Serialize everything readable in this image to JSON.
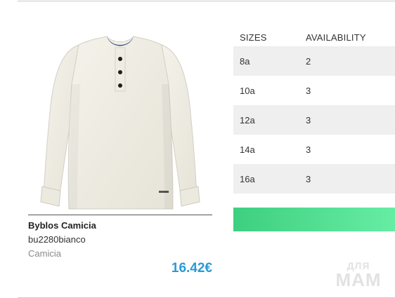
{
  "product": {
    "name": "Byblos Camicia",
    "code": "bu2280bianco",
    "category": "Camicia",
    "price": "16.42€"
  },
  "availability_table": {
    "headers": [
      "SIZES",
      "AVAILABILITY"
    ],
    "rows": [
      {
        "size": "8a",
        "availability": "2"
      },
      {
        "size": "10a",
        "availability": "3"
      },
      {
        "size": "12a",
        "availability": "3"
      },
      {
        "size": "14a",
        "availability": "3"
      },
      {
        "size": "16a",
        "availability": "3"
      }
    ]
  },
  "action_button": {
    "label": "",
    "color_start": "#3ecf80",
    "color_end": "#66eda4"
  },
  "watermark": {
    "line1": "ДЛЯ",
    "line2": "МАМ"
  },
  "colors": {
    "price": "#2a9ad6",
    "row_stripe": "#efefef"
  }
}
